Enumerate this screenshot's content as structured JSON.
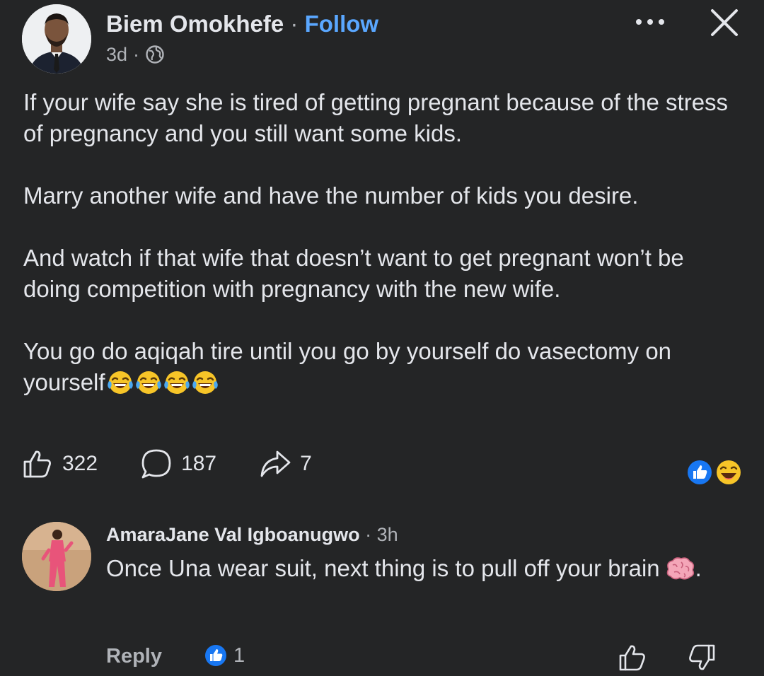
{
  "post": {
    "author": "Biem Omokhefe",
    "separator": "·",
    "follow_label": "Follow",
    "time": "3d",
    "time_separator": "·",
    "audience_icon": "globe-icon",
    "paragraphs": [
      "If your wife say she is tired of getting pregnant because of the stress of pregnancy and you still want some kids.",
      "Marry another wife and  have the number of kids you desire.",
      "And watch if that wife that  doesn’t want to get pregnant won’t be doing competition with pregnancy with the new wife.",
      "You go do aqiqah tire until you go by yourself do vasectomy on yourself"
    ],
    "trailing_emoji": "face-with-tears-of-joy x4",
    "stats": {
      "likes": "322",
      "comments": "187",
      "shares": "7"
    },
    "reactions": [
      "like",
      "haha"
    ]
  },
  "comment": {
    "author": "AmaraJane Val Igboanugwo",
    "separator": "·",
    "time": "3h",
    "text": "Once Una wear suit, next thing is to pull off your brain",
    "trailing_punct": ".",
    "reply_label": "Reply",
    "like_count": "1"
  },
  "colors": {
    "background": "#242526",
    "text": "#e4e6eb",
    "secondary": "#b0b3b8",
    "link": "#5aa7ff",
    "like_blue": "#1877f2"
  }
}
